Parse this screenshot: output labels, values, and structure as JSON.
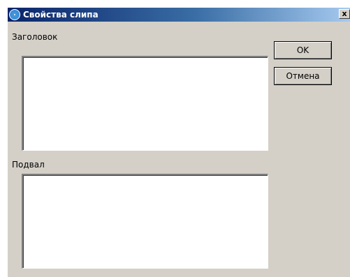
{
  "window": {
    "title": "Свойства слипа",
    "close_glyph": "x"
  },
  "form": {
    "header_label": "Заголовок",
    "header_value": "",
    "footer_label": "Подвал",
    "footer_value": ""
  },
  "buttons": {
    "ok_label": "OK",
    "cancel_label": "Отмена"
  },
  "icons": {
    "title_icon": "app-gear-icon"
  }
}
